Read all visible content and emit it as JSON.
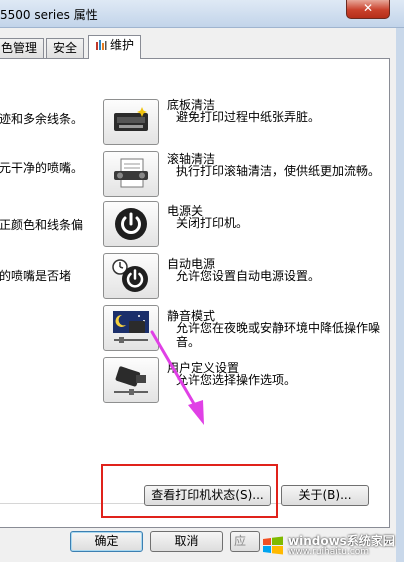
{
  "window": {
    "title": "5500 series 属性",
    "close_glyph": "✕"
  },
  "tabs": [
    {
      "label": "颜色管理",
      "visible_label": "色管理"
    },
    {
      "label": "安全"
    },
    {
      "label": "维护",
      "icon": "maintenance-tools-icon",
      "active": true
    }
  ],
  "left_partial_texts": [
    "迹和多余线条。",
    "元干净的喷嘴。",
    "正颜色和线条偏",
    "的喷嘴是否堵"
  ],
  "maintenance_items": [
    {
      "title": "底板清洁",
      "description": "避免打印过程中纸张弄脏。",
      "icon": "bottom-plate-cleaning-icon"
    },
    {
      "title": "滚轴清洁",
      "description": "执行打印滚轴清洁，使供纸更加流畅。",
      "icon": "roller-cleaning-icon"
    },
    {
      "title": "电源关",
      "description": "关闭打印机。",
      "icon": "power-off-icon"
    },
    {
      "title": "自动电源",
      "description": "允许您设置自动电源设置。",
      "icon": "auto-power-icon"
    },
    {
      "title": "静音模式",
      "description": "允许您在夜晚或安静环境中降低操作噪音。",
      "icon": "quiet-mode-icon"
    },
    {
      "title": "用户定义设置",
      "description": "允许您选择操作选项。",
      "icon": "custom-settings-icon"
    }
  ],
  "actions": {
    "view_status": "查看打印机状态(S)...",
    "about": "关于(B)..."
  },
  "dialog_buttons": {
    "ok": "确定",
    "cancel": "取消",
    "apply": "应"
  },
  "annotation": {
    "highlight_color": "#e0221b",
    "arrow_color": "#e040e6"
  },
  "watermark": {
    "brand": "windows系统家园",
    "site": "www.ruihaitu.com"
  }
}
